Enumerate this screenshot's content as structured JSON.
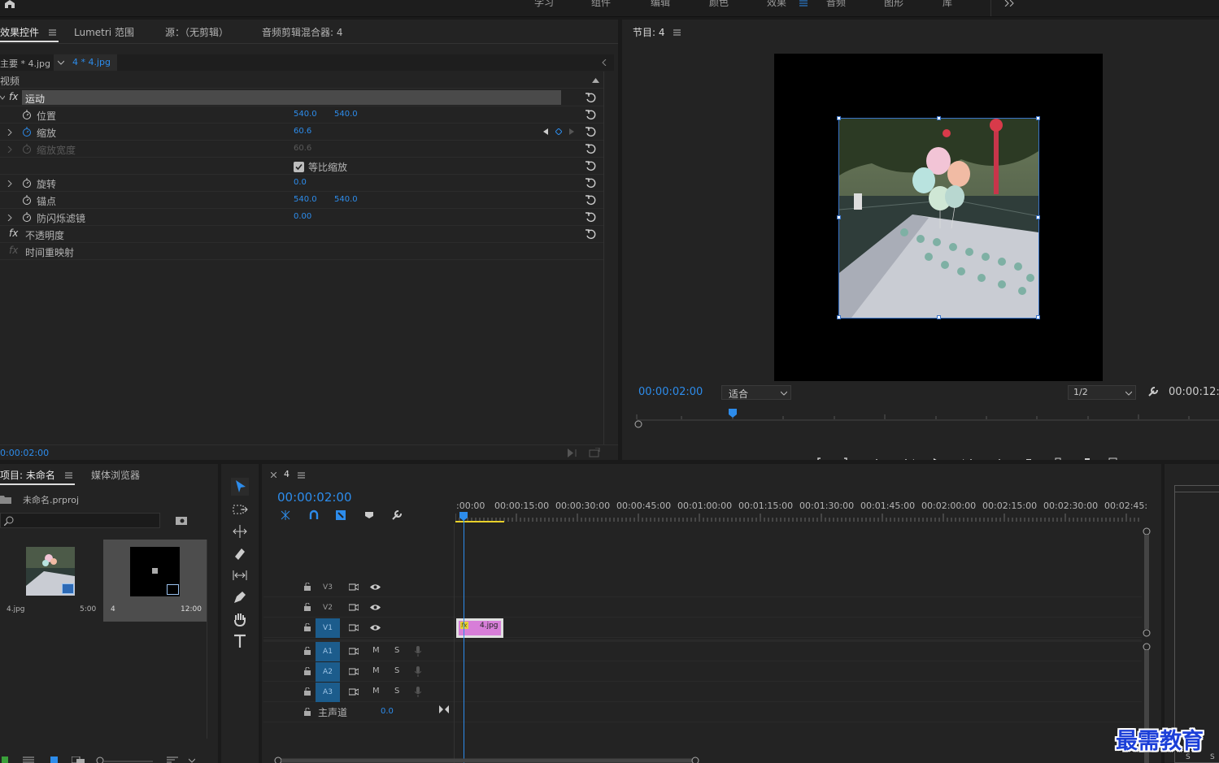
{
  "workspaces": [
    "学习",
    "组件",
    "编辑",
    "颜色",
    "效果",
    "音频",
    "图形",
    "库"
  ],
  "workspace_active": "效果",
  "effect_controls": {
    "tabs": [
      "效果控件",
      "Lumetri 范围",
      "源：（无剪辑）",
      "音频剪辑混合器: 4"
    ],
    "active_tab": "效果控件",
    "clip_master": "主要 * 4.jpg",
    "clip_seq": "4 * 4.jpg",
    "section_video": "视频",
    "motion_label": "运动",
    "rows": [
      {
        "label": "位置",
        "v1": "540.0",
        "v2": "540.0"
      },
      {
        "label": "缩放",
        "v1": "60.6",
        "v2": ""
      },
      {
        "label": "缩放宽度",
        "v1": "60.6",
        "v2": ""
      },
      {
        "label": "",
        "v1": "",
        "v2": ""
      },
      {
        "label": "旋转",
        "v1": "0.0",
        "v2": ""
      },
      {
        "label": "锚点",
        "v1": "540.0",
        "v2": "540.0"
      },
      {
        "label": "防闪烁滤镜",
        "v1": "0.00",
        "v2": ""
      }
    ],
    "uniform_scale_label": "等比缩放",
    "opacity_label": "不透明度",
    "time_remap_label": "时间重映射",
    "timecode": "0:00:02:00"
  },
  "program": {
    "title": "节目: 4",
    "timecode": "00:00:02:00",
    "fit_label": "适合",
    "resolution": "1/2",
    "duration": "00:00:12:"
  },
  "project": {
    "tabs": [
      "项目: 未命名",
      "媒体浏览器"
    ],
    "project_file": "未命名.prproj",
    "items": [
      {
        "name": "4.jpg",
        "duration": "5:00"
      },
      {
        "name": "4",
        "duration": "12:00"
      }
    ]
  },
  "timeline": {
    "seq_name": "4",
    "timecode": "00:00:02:00",
    "ruler": [
      ":00:00",
      "00:00:15:00",
      "00:00:30:00",
      "00:00:45:00",
      "00:01:00:00",
      "00:01:15:00",
      "00:01:30:00",
      "00:01:45:00",
      "00:02:00:00",
      "00:02:15:00",
      "00:02:30:00",
      "00:02:45:"
    ],
    "video_tracks": [
      "V3",
      "V2",
      "V1"
    ],
    "audio_tracks": [
      "A1",
      "A2",
      "A3"
    ],
    "mute_label": "M",
    "solo_label": "S",
    "master_label": "主声道",
    "master_value": "0.0",
    "clip_label": "4.jpg"
  },
  "watermark": "最需教育",
  "meter_labels": [
    "S",
    "S"
  ],
  "colors": {
    "accent": "#2d8ceb",
    "clip": "#d77ed8",
    "panel": "#232323"
  }
}
